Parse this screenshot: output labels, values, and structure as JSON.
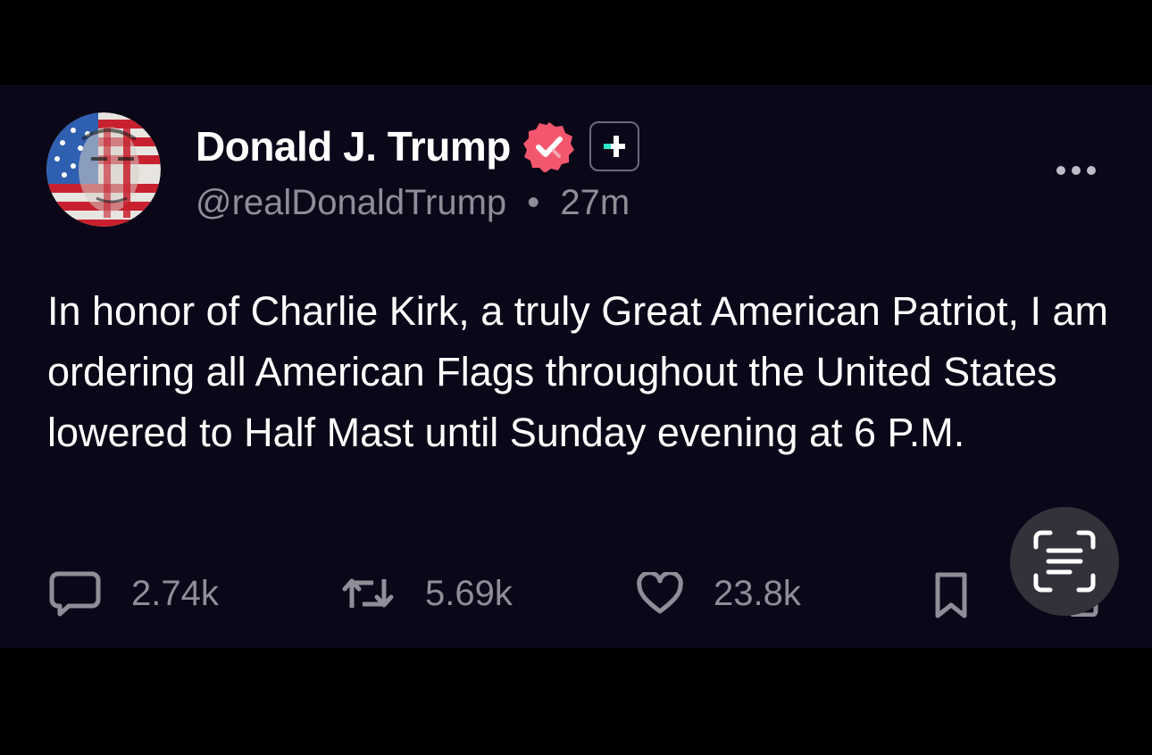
{
  "post": {
    "author": {
      "display_name": "Donald J. Trump",
      "handle": "@realDonaldTrump",
      "separator": "•",
      "time_ago": "27m",
      "verified": true,
      "badge_color": "#f2576e"
    },
    "body": "In honor of Charlie Kirk, a truly Great American Patriot, I am ordering all American Flags throughout the United States lowered to Half Mast until Sunday evening at 6 P.M.",
    "actions": {
      "replies": "2.74k",
      "reposts": "5.69k",
      "likes": "23.8k"
    }
  },
  "icons": {
    "more": "more-horizontal-icon",
    "reply": "comment-bubble-icon",
    "repost": "repost-arrows-icon",
    "like": "heart-icon",
    "bookmark": "bookmark-icon",
    "scan": "text-scan-icon"
  },
  "colors": {
    "background": "#0a0818",
    "text_primary": "#ffffff",
    "text_secondary": "#8e8d98",
    "accent_teal": "#2ee6c8"
  }
}
